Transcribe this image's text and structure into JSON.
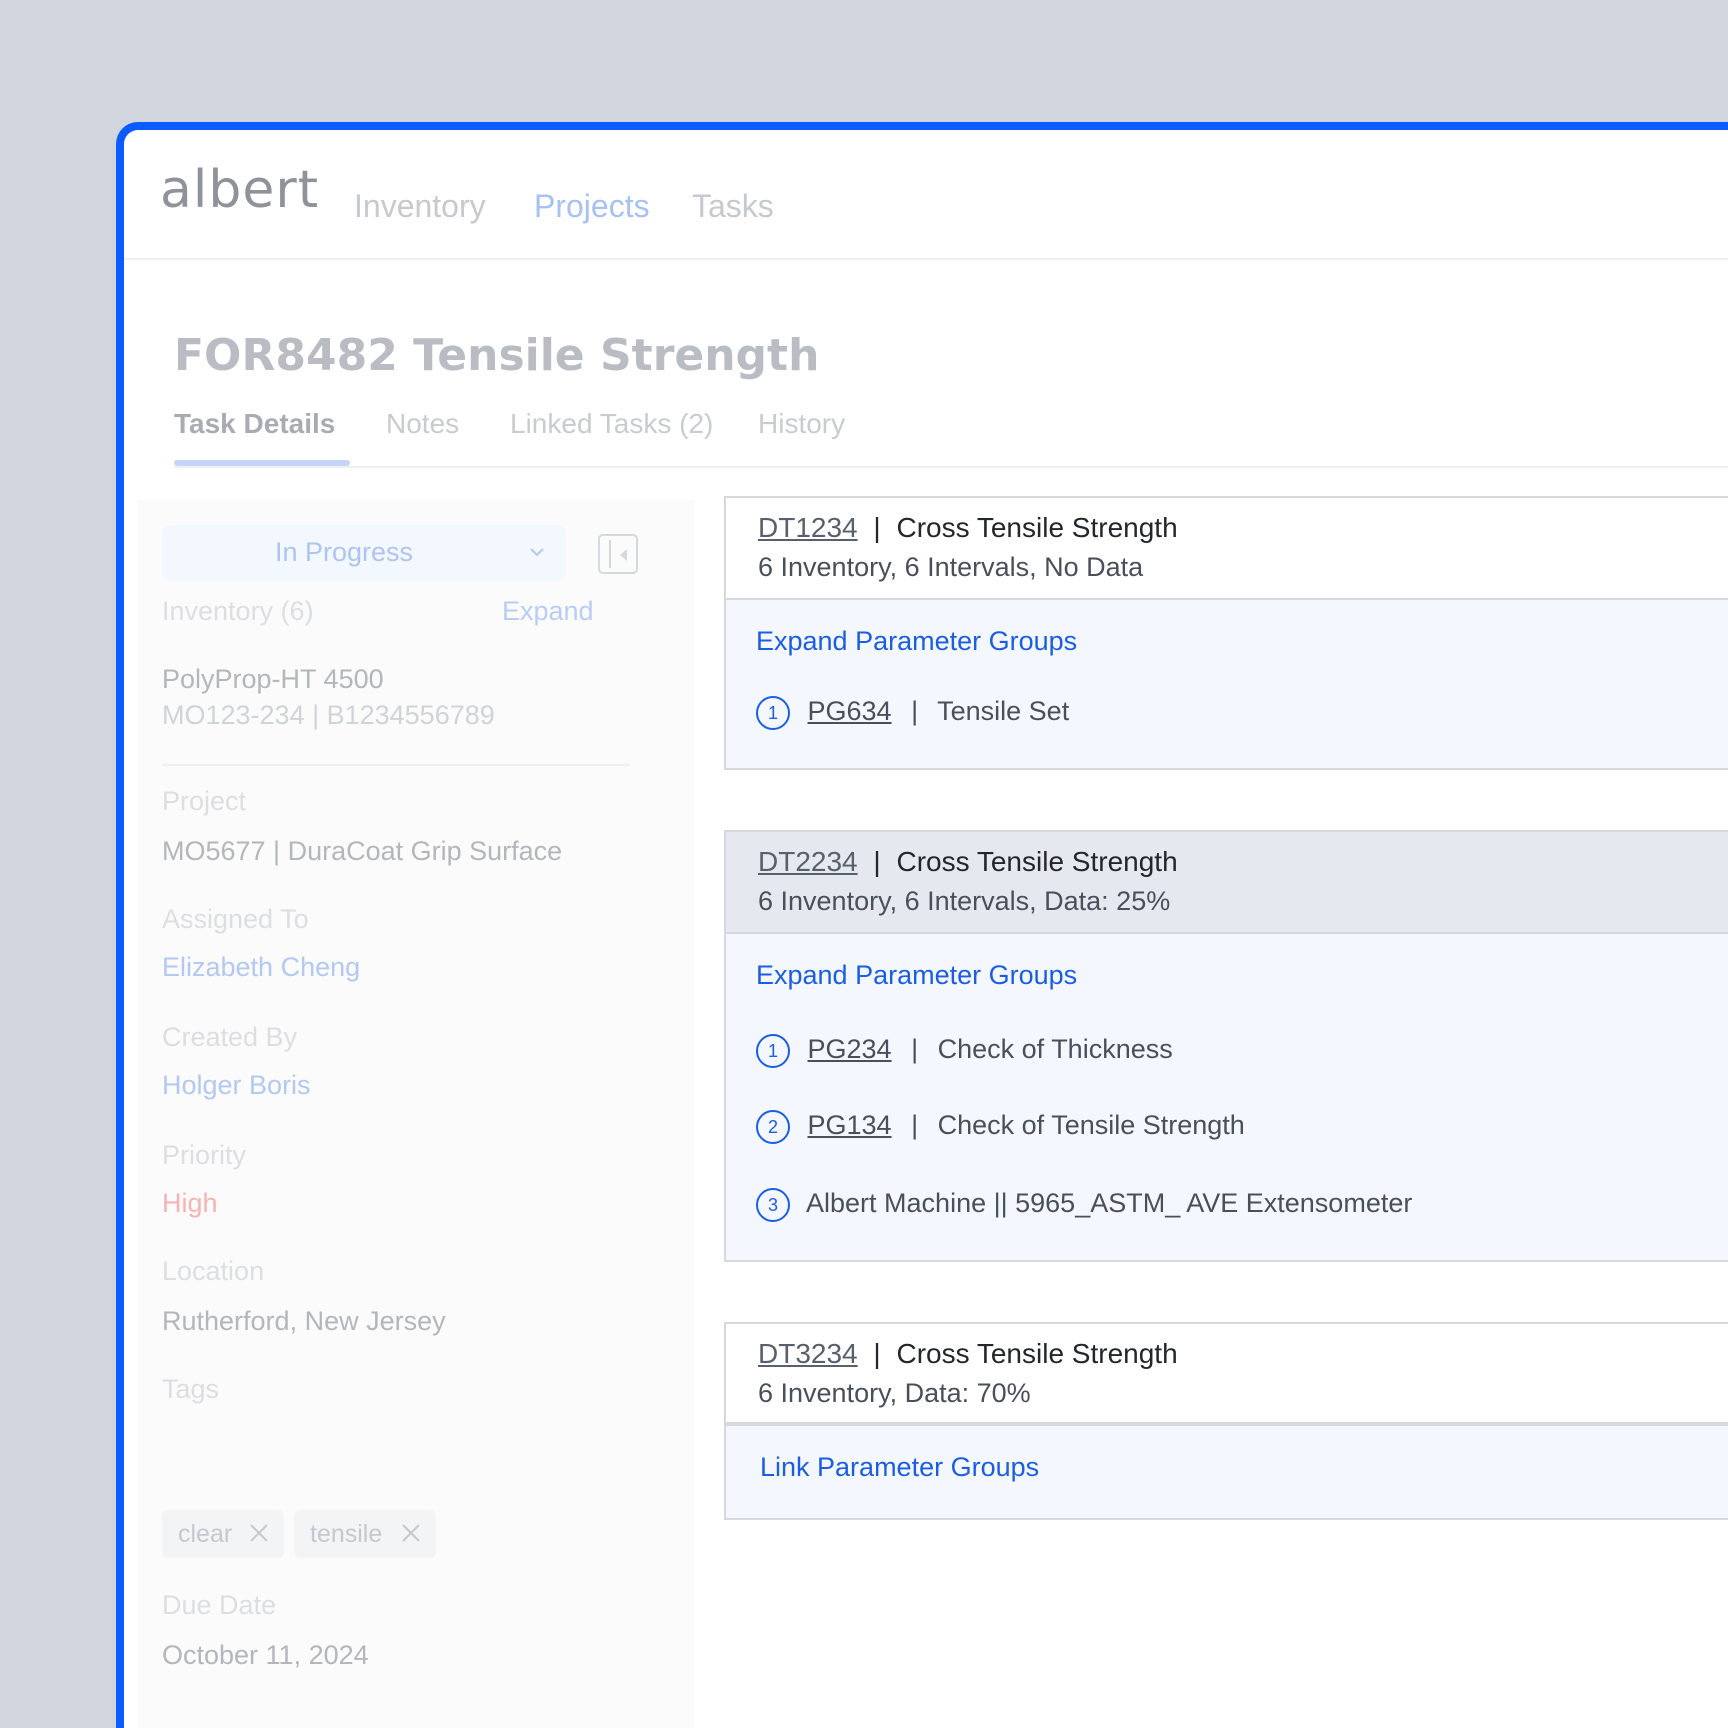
{
  "app": {
    "logo": "albert"
  },
  "nav": {
    "items": [
      "Inventory",
      "Projects",
      "Tasks"
    ]
  },
  "page": {
    "title": "FOR8482 Tensile Strength",
    "tabs": [
      "Task Details",
      "Notes",
      "Linked Tasks (2)",
      "History"
    ]
  },
  "sidebar": {
    "status": "In Progress",
    "inventory_label": "Inventory (6)",
    "expand_label": "Expand",
    "inventory_name": "PolyProp-HT 4500",
    "inventory_ids": "MO123-234  |  B1234556789",
    "project_label": "Project",
    "project_value": "MO5677 | DuraCoat Grip Surface",
    "assigned_label": "Assigned To",
    "assigned_value": "Elizabeth Cheng",
    "created_label": "Created By",
    "created_value": "Holger Boris",
    "priority_label": "Priority",
    "priority_value": "High",
    "location_label": "Location",
    "location_value": "Rutherford, New Jersey",
    "tags_label": "Tags",
    "tags": [
      "clear",
      "tensile"
    ],
    "due_label": "Due Date",
    "due_value": "October 11, 2024"
  },
  "cards": [
    {
      "id": "DT1234",
      "title": "Cross Tensile Strength",
      "sub": "6 Inventory, 6 Intervals, No Data",
      "action": "Expand Parameter Groups",
      "groups": [
        {
          "num": "1",
          "id": "PG634",
          "name": "Tensile Set"
        }
      ]
    },
    {
      "id": "DT2234",
      "title": "Cross Tensile Strength",
      "sub": "6 Inventory, 6 Intervals, Data: 25%",
      "action": "Expand Parameter Groups",
      "groups": [
        {
          "num": "1",
          "id": "PG234",
          "name": "Check of Thickness"
        },
        {
          "num": "2",
          "id": "PG134",
          "name": "Check of Tensile Strength"
        },
        {
          "num": "3",
          "name": "Albert Machine || 5965_ASTM_ AVE Extensometer"
        }
      ]
    },
    {
      "id": "DT3234",
      "title": "Cross Tensile Strength",
      "sub": "6 Inventory, Data: 70%",
      "action": "Link Parameter Groups"
    }
  ],
  "separator": "|",
  "colors": {
    "accent": "#0b5cff",
    "link": "#1b5ee0",
    "priority_high": "#f5b3b3"
  }
}
